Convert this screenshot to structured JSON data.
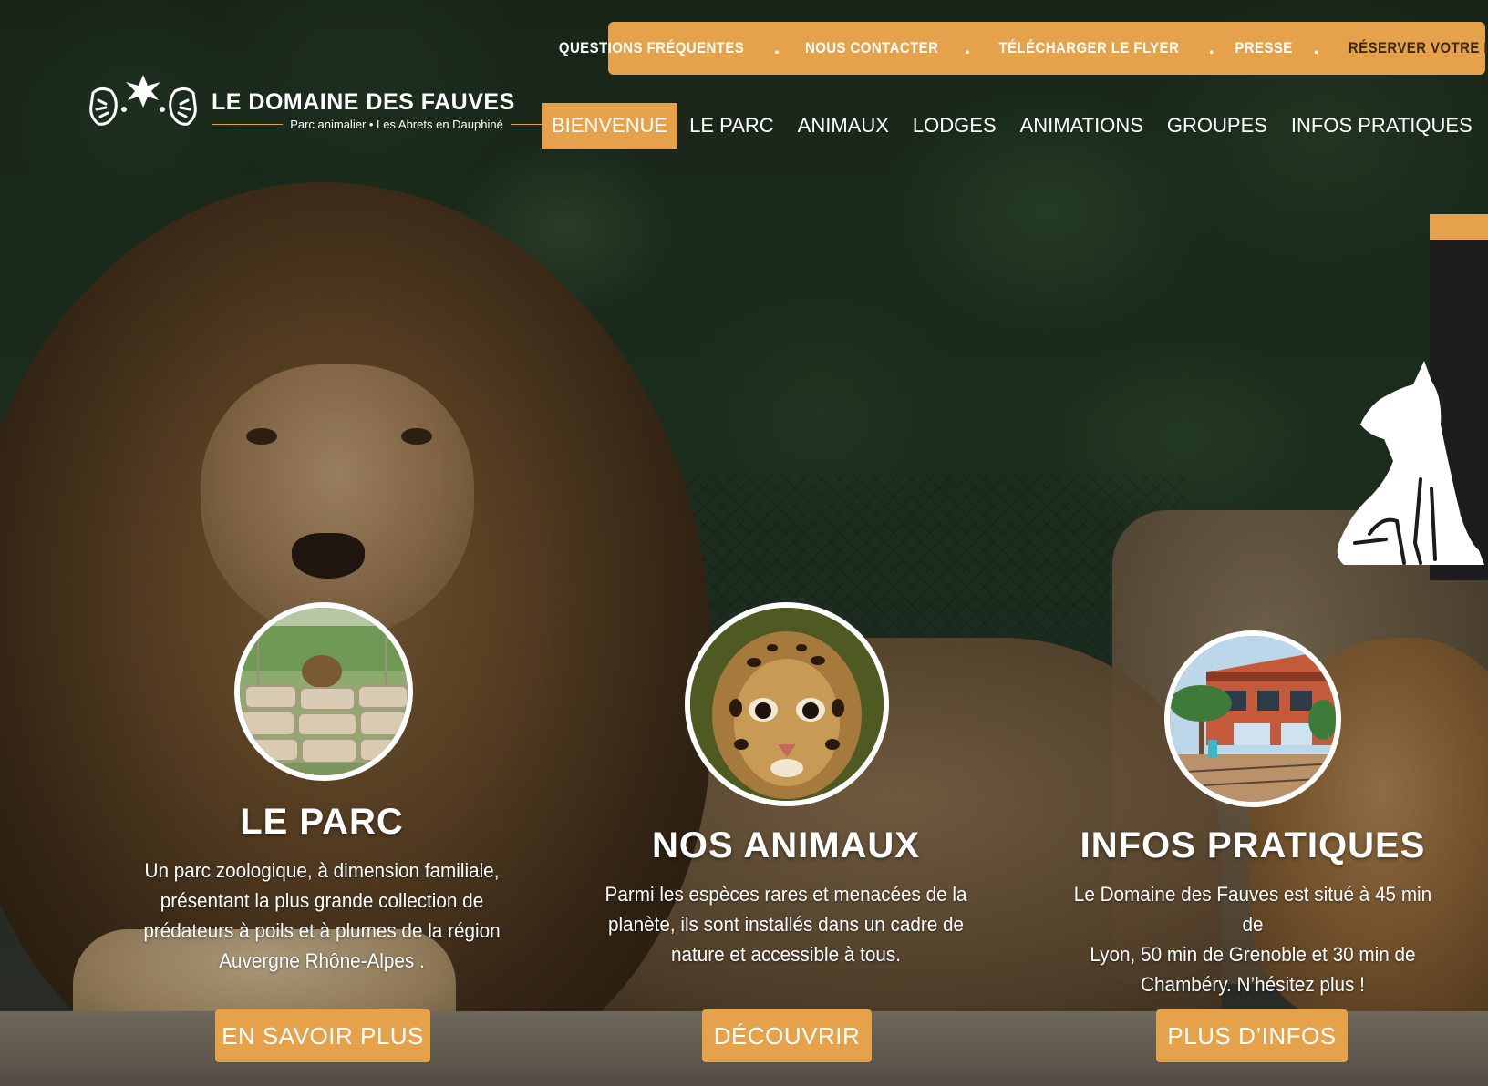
{
  "brand": {
    "title": "LE DOMAINE DES FAUVES",
    "subtitle": "Parc animalier • Les Abrets en Dauphiné",
    "accent_color": "#e5a24a"
  },
  "top_links": [
    {
      "label": "QUESTIONS FRÉQUENTES"
    },
    {
      "label": "NOUS CONTACTER"
    },
    {
      "label": "TÉLÉCHARGER LE FLYER"
    },
    {
      "label": "PRESSE"
    },
    {
      "label": "RÉSERVER VOTRE LODGE"
    }
  ],
  "top_separator": ".",
  "nav": [
    {
      "label": "BIENVENUE",
      "active": true
    },
    {
      "label": "LE PARC"
    },
    {
      "label": "ANIMAUX"
    },
    {
      "label": "LODGES"
    },
    {
      "label": "ANIMATIONS"
    },
    {
      "label": "GROUPES"
    },
    {
      "label": "INFOS PRATIQUES"
    }
  ],
  "side_widget": {
    "icon": "sitting-cat-icon"
  },
  "features": [
    {
      "title": "LE PARC",
      "lines": [
        "Un parc zoologique, à dimension familiale,",
        "présentant la plus grande collection de",
        "prédateurs à poils et à plumes de la région",
        "Auvergne Rhône-Alpes ."
      ],
      "button": "EN SAVOIR PLUS",
      "image": "lion-enclosure-photo"
    },
    {
      "title": "NOS ANIMAUX",
      "lines": [
        "Parmi les espèces rares et menacées de la",
        "planète, ils sont installés dans un cadre de",
        "nature et accessible à tous."
      ],
      "button": "DÉCOUVRIR",
      "image": "ocelot-photo"
    },
    {
      "title": "INFOS PRATIQUES",
      "lines": [
        "Le Domaine des Fauves est situé à 45 min de",
        "Lyon, 50 min de Grenoble et 30 min de",
        "Chambéry. N’hésitez plus !"
      ],
      "button": "PLUS D’INFOS",
      "image": "park-entrance-photo"
    }
  ]
}
